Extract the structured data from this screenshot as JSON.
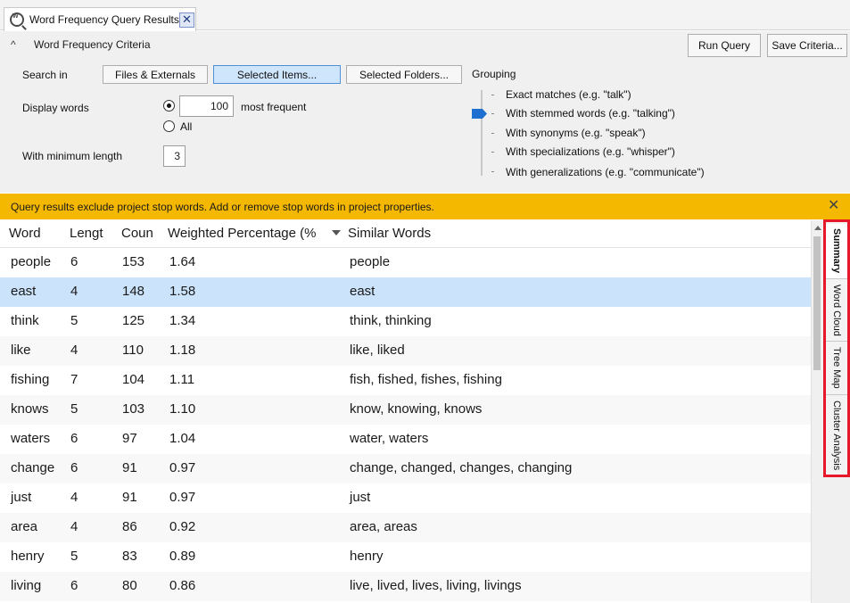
{
  "tab": {
    "title": "Word Frequency Query Results",
    "close": "✕"
  },
  "criteria": {
    "title": "Word Frequency Criteria",
    "run_query": "Run Query",
    "save_criteria": "Save Criteria...",
    "search_in_label": "Search in",
    "search_in_options": [
      "Files & Externals",
      "Selected Items...",
      "Selected Folders..."
    ],
    "search_in_selected": "Selected Items...",
    "display_words_label": "Display words",
    "display_count": "100",
    "most_frequent": "most frequent",
    "all_label": "All",
    "display_mode": "most frequent",
    "min_length_label": "With minimum length",
    "min_length": "3",
    "grouping_label": "Grouping",
    "grouping_options": [
      "Exact matches (e.g. \"talk\")",
      "With stemmed words (e.g. \"talking\")",
      "With synonyms (e.g. \"speak\")",
      "With specializations (e.g. \"whisper\")",
      "With generalizations (e.g. \"communicate\")"
    ],
    "grouping_selected": "With stemmed words (e.g. \"talking\")"
  },
  "banner": {
    "text": "Query results exclude project stop words. Add or remove stop words in project properties.",
    "color": "#f5b800"
  },
  "table": {
    "columns": [
      "Word",
      "Lengt",
      "Coun",
      "Weighted Percentage (%",
      "Similar Words"
    ],
    "sort_column": "Weighted Percentage (%",
    "sort_direction": "descending",
    "selected_row": "east",
    "rows": [
      [
        "people",
        "6",
        "153",
        "1.64",
        "people"
      ],
      [
        "east",
        "4",
        "148",
        "1.58",
        "east"
      ],
      [
        "think",
        "5",
        "125",
        "1.34",
        "think, thinking"
      ],
      [
        "like",
        "4",
        "110",
        "1.18",
        "like, liked"
      ],
      [
        "fishing",
        "7",
        "104",
        "1.11",
        "fish, fished, fishes, fishing"
      ],
      [
        "knows",
        "5",
        "103",
        "1.10",
        "know, knowing, knows"
      ],
      [
        "waters",
        "6",
        "97",
        "1.04",
        "water, waters"
      ],
      [
        "change",
        "6",
        "91",
        "0.97",
        "change, changed, changes, changing"
      ],
      [
        "just",
        "4",
        "91",
        "0.97",
        "just"
      ],
      [
        "area",
        "4",
        "86",
        "0.92",
        "area, areas"
      ],
      [
        "henry",
        "5",
        "83",
        "0.89",
        "henry"
      ],
      [
        "living",
        "6",
        "80",
        "0.86",
        "live, lived, lives, living, livings"
      ]
    ]
  },
  "side_tabs": [
    "Summary",
    "Word Cloud",
    "Tree Map",
    "Cluster Analysis"
  ],
  "side_tab_active": "Summary",
  "colors": {
    "highlight_border": "#e8182b",
    "selection": "#cce4fb",
    "accent": "#1e6fd0"
  }
}
